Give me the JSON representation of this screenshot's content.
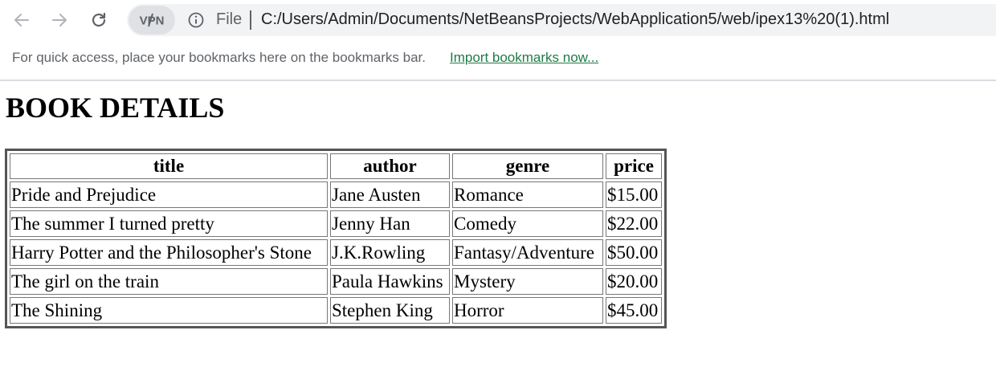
{
  "browser": {
    "vpn_label": "VPN",
    "scheme_label": "File",
    "url": "C:/Users/Admin/Documents/NetBeansProjects/WebApplication5/web/ipex13%20(1).html",
    "icons": [
      "back-icon",
      "forward-icon",
      "reload-icon",
      "vpn-icon",
      "info-icon"
    ]
  },
  "bookmarks_bar": {
    "message": "For quick access, place your bookmarks here on the bookmarks bar.",
    "import_link": "Import bookmarks now..."
  },
  "page": {
    "heading": "BOOK DETAILS",
    "table": {
      "columns": [
        "title",
        "author",
        "genre",
        "price"
      ],
      "rows": [
        [
          "Pride and Prejudice",
          "Jane Austen",
          "Romance",
          "$15.00"
        ],
        [
          "The summer I turned pretty",
          "Jenny Han",
          "Comedy",
          "$22.00"
        ],
        [
          "Harry Potter and the Philosopher's Stone",
          "J.K.Rowling",
          "Fantasy/Adventure",
          "$50.00"
        ],
        [
          "The girl on the train",
          "Paula Hawkins",
          "Mystery",
          "$20.00"
        ],
        [
          "The Shining",
          "Stephen King",
          "Horror",
          "$45.00"
        ]
      ]
    }
  },
  "colors": {
    "omnibox_bg": "#f1f3f4",
    "link": "#1e7b46",
    "chrome_text": "#5f6368"
  }
}
